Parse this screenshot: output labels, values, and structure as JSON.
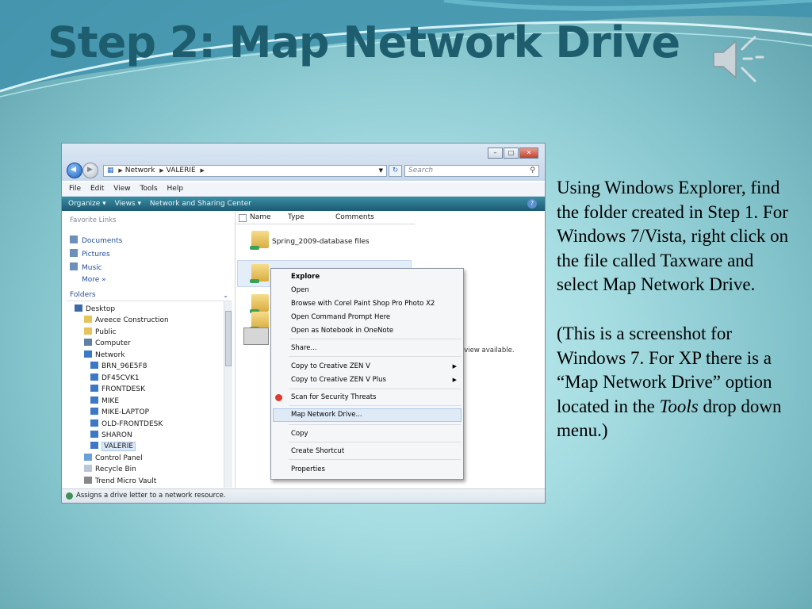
{
  "slide": {
    "title": "Step 2: Map Network Drive",
    "paragraph1": "Using Windows Explorer, find the folder created in Step 1.  For Windows 7/Vista, right click on the file called Taxware and select Map Network Drive.",
    "paragraph2_before": "(This is a screenshot for Windows 7. For XP there is a “Map Network Drive” option located in the ",
    "paragraph2_italic": "Tools",
    "paragraph2_after": " drop down menu.)"
  },
  "colors": {
    "title": "#1d5d6e",
    "background": "#a6dde2",
    "command_bar": "#1c5a73"
  },
  "explorer": {
    "address": {
      "root": "Network",
      "current": "VALERIE"
    },
    "search_placeholder": "Search",
    "menu": [
      "File",
      "Edit",
      "View",
      "Tools",
      "Help"
    ],
    "commands": [
      "Organize ▾",
      "Views ▾",
      "Network and Sharing Center"
    ],
    "favorite_links_heading": "Favorite Links",
    "favorites": [
      "Documents",
      "Pictures",
      "Music",
      "More »"
    ],
    "folders_heading": "Folders",
    "tree": [
      "Desktop",
      "Aveece Construction",
      "Public",
      "Computer",
      "Network",
      "BRN_96E5F8",
      "DF45CVK1",
      "FRONTDESK",
      "MIKE",
      "MIKE-LAPTOP",
      "OLD-FRONTDESK",
      "SHARON",
      "VALERIE",
      "Control Panel",
      "Recycle Bin",
      "Trend Micro Vault"
    ],
    "columns": [
      "Name",
      "Type",
      "Comments"
    ],
    "files": [
      "Spring_2009-database files"
    ],
    "preview_text": "eview available.",
    "status_text": "Assigns a drive letter to a network resource."
  },
  "context_menu": [
    "Explore",
    "Open",
    "Browse with Corel Paint Shop Pro Photo X2",
    "Open Command Prompt Here",
    "Open as Notebook in OneNote",
    "Share...",
    "Copy to Creative ZEN V",
    "Copy to Creative ZEN V Plus",
    "Scan for Security Threats",
    "Map Network Drive...",
    "Copy",
    "Create Shortcut",
    "Properties"
  ]
}
